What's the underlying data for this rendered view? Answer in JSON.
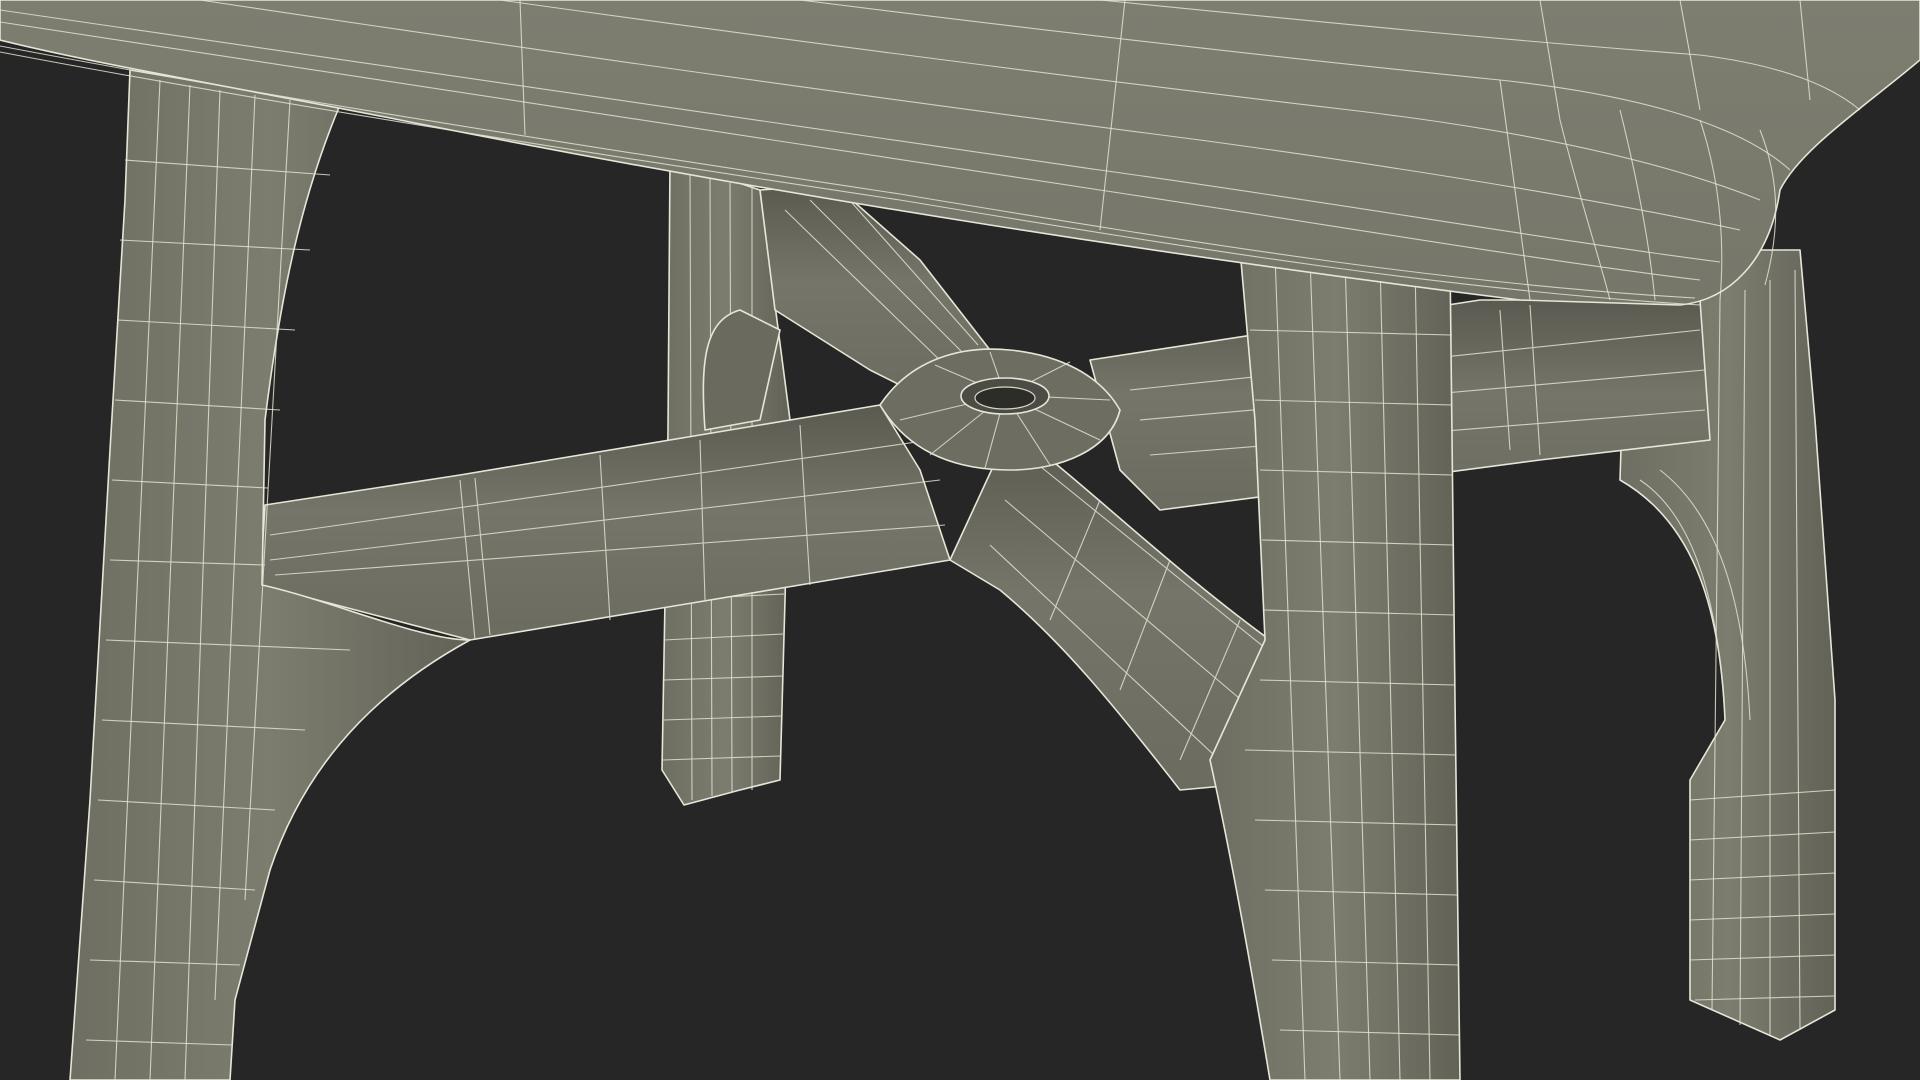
{
  "scene": {
    "background_color": "#262626",
    "surface_color": "#7b7b6e",
    "surface_dark_color": "#55554b",
    "wire_color": "#e2e2d2"
  },
  "parts": [
    {
      "id": "tabletop",
      "kind": "slab"
    },
    {
      "id": "leg-front-left",
      "kind": "leg"
    },
    {
      "id": "leg-front-right",
      "kind": "leg"
    },
    {
      "id": "leg-back-left",
      "kind": "leg"
    },
    {
      "id": "leg-back-right",
      "kind": "leg"
    },
    {
      "id": "cross-stretcher",
      "kind": "brace"
    },
    {
      "id": "center-hub",
      "kind": "hub-with-hole"
    }
  ]
}
